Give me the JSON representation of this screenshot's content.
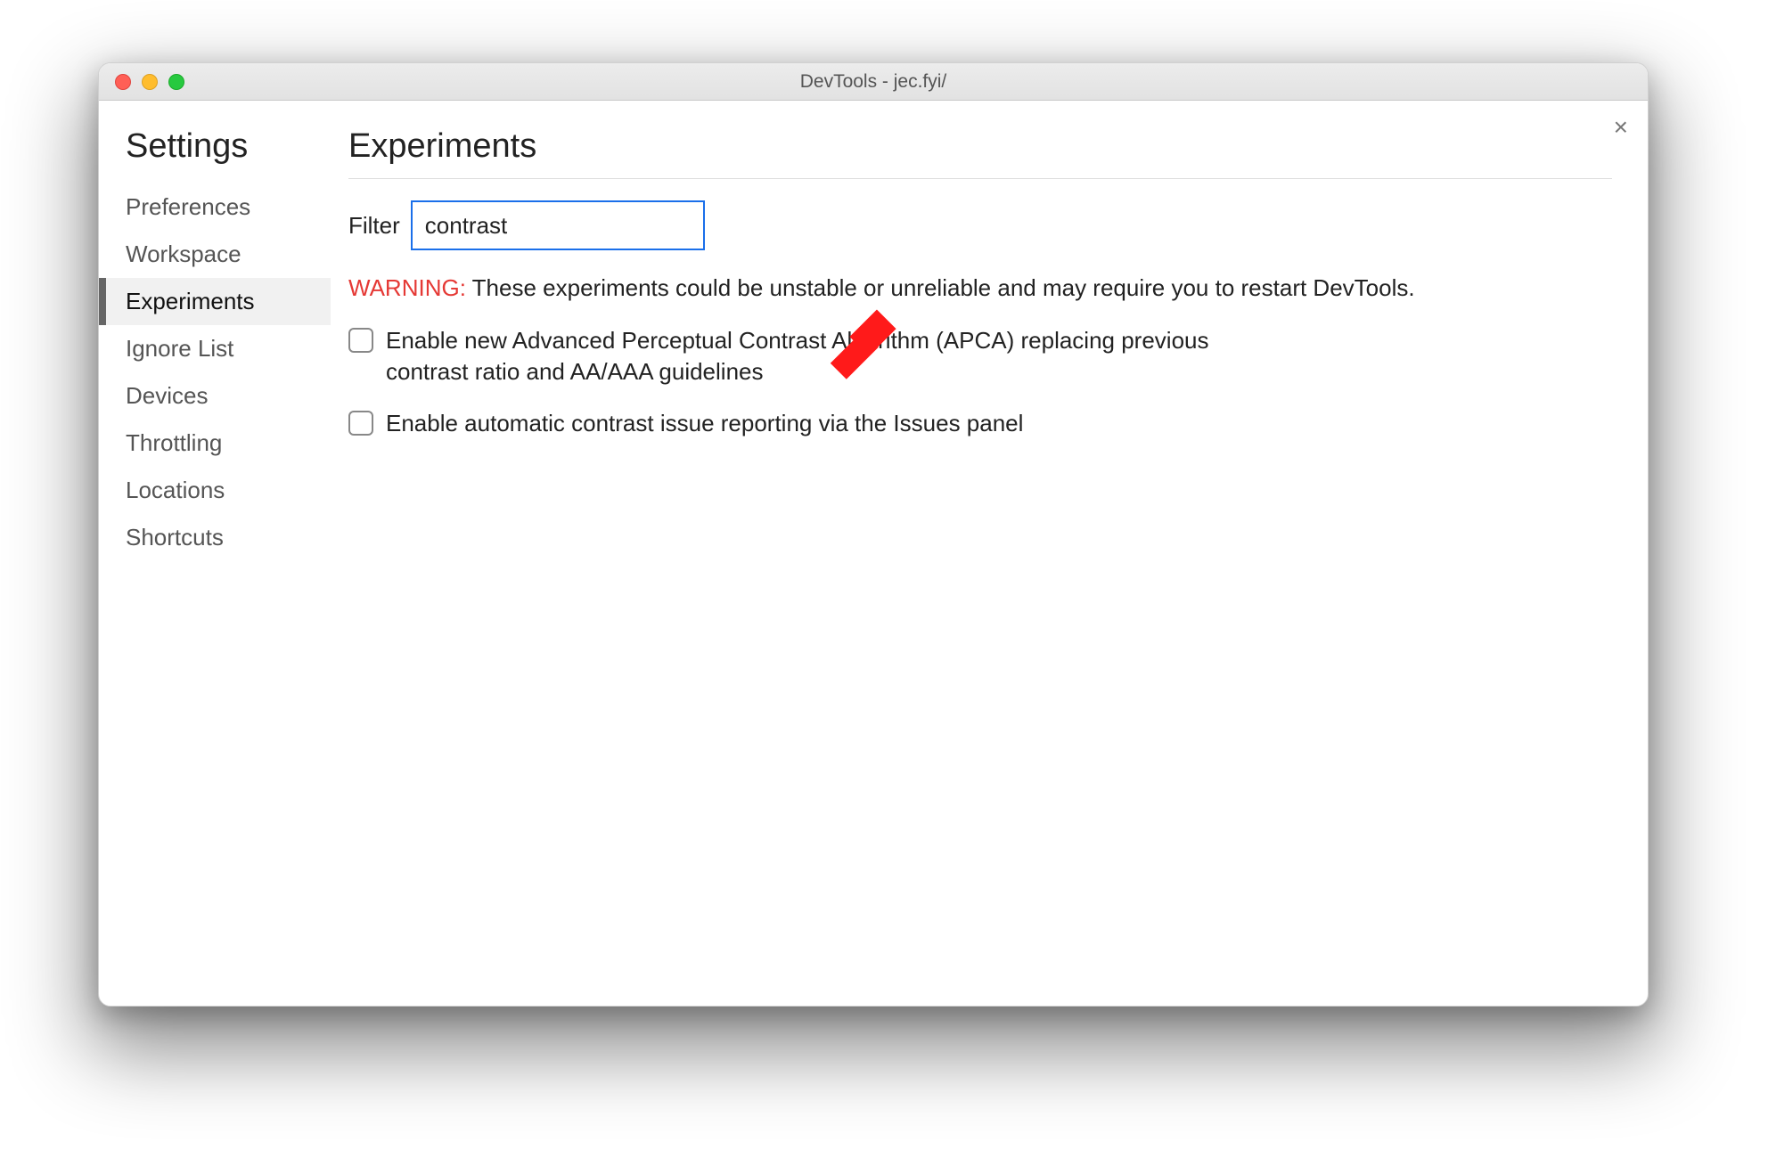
{
  "window": {
    "title": "DevTools - jec.fyi/"
  },
  "close_label": "×",
  "sidebar": {
    "title": "Settings",
    "items": [
      {
        "label": "Preferences"
      },
      {
        "label": "Workspace"
      },
      {
        "label": "Experiments"
      },
      {
        "label": "Ignore List"
      },
      {
        "label": "Devices"
      },
      {
        "label": "Throttling"
      },
      {
        "label": "Locations"
      },
      {
        "label": "Shortcuts"
      }
    ],
    "active_index": 2
  },
  "main": {
    "heading": "Experiments",
    "filter_label": "Filter",
    "filter_value": "contrast",
    "warning_label": "WARNING:",
    "warning_text": " These experiments could be unstable or unreliable and may require you to restart DevTools.",
    "experiments": [
      {
        "label": "Enable new Advanced Perceptual Contrast Algorithm (APCA) replacing previous contrast ratio and AA/AAA guidelines",
        "checked": false
      },
      {
        "label": "Enable automatic contrast issue reporting via the Issues panel",
        "checked": false
      }
    ]
  },
  "annotation": {
    "arrow_color": "#ff1a1a"
  }
}
